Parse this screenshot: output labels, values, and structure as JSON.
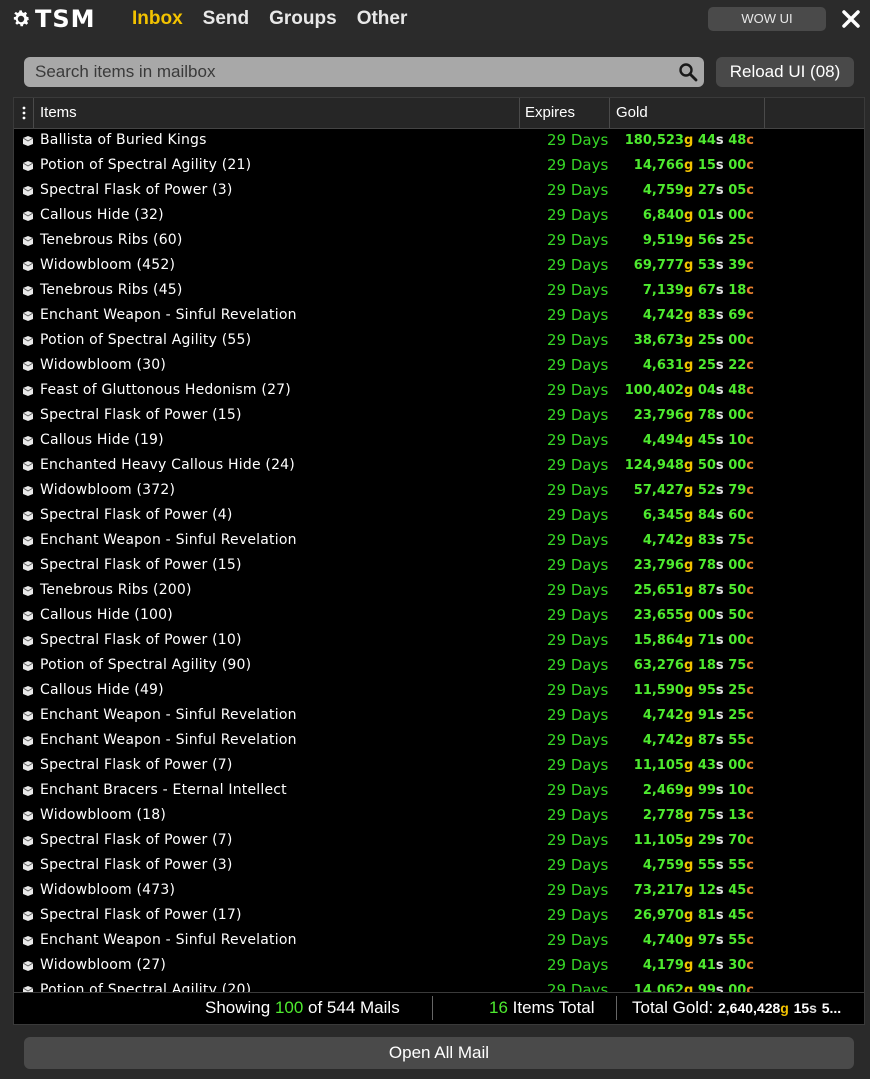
{
  "app": {
    "logo_text": "TSM",
    "tabs": [
      {
        "label": "Inbox",
        "active": true
      },
      {
        "label": "Send",
        "active": false
      },
      {
        "label": "Groups",
        "active": false
      },
      {
        "label": "Other",
        "active": false
      }
    ],
    "wowui_label": "WOW UI"
  },
  "search": {
    "placeholder": "Search items in mailbox",
    "value": ""
  },
  "reload_label": "Reload UI (08)",
  "table": {
    "columns": {
      "items": "Items",
      "expires": "Expires",
      "gold": "Gold"
    },
    "rows": [
      {
        "item": "Ballista of Buried Kings",
        "expires": "29 Days",
        "g": "180,523",
        "s": "44",
        "c": "48"
      },
      {
        "item": "Potion of Spectral Agility (21)",
        "expires": "29 Days",
        "g": "14,766",
        "s": "15",
        "c": "00"
      },
      {
        "item": "Spectral Flask of Power (3)",
        "expires": "29 Days",
        "g": "4,759",
        "s": "27",
        "c": "05"
      },
      {
        "item": "Callous Hide (32)",
        "expires": "29 Days",
        "g": "6,840",
        "s": "01",
        "c": "00"
      },
      {
        "item": "Tenebrous Ribs (60)",
        "expires": "29 Days",
        "g": "9,519",
        "s": "56",
        "c": "25"
      },
      {
        "item": "Widowbloom (452)",
        "expires": "29 Days",
        "g": "69,777",
        "s": "53",
        "c": "39"
      },
      {
        "item": "Tenebrous Ribs (45)",
        "expires": "29 Days",
        "g": "7,139",
        "s": "67",
        "c": "18"
      },
      {
        "item": "Enchant Weapon - Sinful Revelation",
        "expires": "29 Days",
        "g": "4,742",
        "s": "83",
        "c": "69"
      },
      {
        "item": "Potion of Spectral Agility (55)",
        "expires": "29 Days",
        "g": "38,673",
        "s": "25",
        "c": "00"
      },
      {
        "item": "Widowbloom (30)",
        "expires": "29 Days",
        "g": "4,631",
        "s": "25",
        "c": "22"
      },
      {
        "item": "Feast of Gluttonous Hedonism (27)",
        "expires": "29 Days",
        "g": "100,402",
        "s": "04",
        "c": "48"
      },
      {
        "item": "Spectral Flask of Power (15)",
        "expires": "29 Days",
        "g": "23,796",
        "s": "78",
        "c": "00"
      },
      {
        "item": "Callous Hide (19)",
        "expires": "29 Days",
        "g": "4,494",
        "s": "45",
        "c": "10"
      },
      {
        "item": "Enchanted Heavy Callous Hide (24)",
        "expires": "29 Days",
        "g": "124,948",
        "s": "50",
        "c": "00"
      },
      {
        "item": "Widowbloom (372)",
        "expires": "29 Days",
        "g": "57,427",
        "s": "52",
        "c": "79"
      },
      {
        "item": "Spectral Flask of Power (4)",
        "expires": "29 Days",
        "g": "6,345",
        "s": "84",
        "c": "60"
      },
      {
        "item": "Enchant Weapon - Sinful Revelation",
        "expires": "29 Days",
        "g": "4,742",
        "s": "83",
        "c": "75"
      },
      {
        "item": "Spectral Flask of Power (15)",
        "expires": "29 Days",
        "g": "23,796",
        "s": "78",
        "c": "00"
      },
      {
        "item": "Tenebrous Ribs (200)",
        "expires": "29 Days",
        "g": "25,651",
        "s": "87",
        "c": "50"
      },
      {
        "item": "Callous Hide (100)",
        "expires": "29 Days",
        "g": "23,655",
        "s": "00",
        "c": "50"
      },
      {
        "item": "Spectral Flask of Power (10)",
        "expires": "29 Days",
        "g": "15,864",
        "s": "71",
        "c": "00"
      },
      {
        "item": "Potion of Spectral Agility (90)",
        "expires": "29 Days",
        "g": "63,276",
        "s": "18",
        "c": "75"
      },
      {
        "item": "Callous Hide (49)",
        "expires": "29 Days",
        "g": "11,590",
        "s": "95",
        "c": "25"
      },
      {
        "item": "Enchant Weapon - Sinful Revelation",
        "expires": "29 Days",
        "g": "4,742",
        "s": "91",
        "c": "25"
      },
      {
        "item": "Enchant Weapon - Sinful Revelation",
        "expires": "29 Days",
        "g": "4,742",
        "s": "87",
        "c": "55"
      },
      {
        "item": "Spectral Flask of Power (7)",
        "expires": "29 Days",
        "g": "11,105",
        "s": "43",
        "c": "00"
      },
      {
        "item": "Enchant Bracers - Eternal Intellect",
        "expires": "29 Days",
        "g": "2,469",
        "s": "99",
        "c": "10"
      },
      {
        "item": "Widowbloom (18)",
        "expires": "29 Days",
        "g": "2,778",
        "s": "75",
        "c": "13"
      },
      {
        "item": "Spectral Flask of Power (7)",
        "expires": "29 Days",
        "g": "11,105",
        "s": "29",
        "c": "70"
      },
      {
        "item": "Spectral Flask of Power (3)",
        "expires": "29 Days",
        "g": "4,759",
        "s": "55",
        "c": "55"
      },
      {
        "item": "Widowbloom (473)",
        "expires": "29 Days",
        "g": "73,217",
        "s": "12",
        "c": "45"
      },
      {
        "item": "Spectral Flask of Power (17)",
        "expires": "29 Days",
        "g": "26,970",
        "s": "81",
        "c": "45"
      },
      {
        "item": "Enchant Weapon - Sinful Revelation",
        "expires": "29 Days",
        "g": "4,740",
        "s": "97",
        "c": "55"
      },
      {
        "item": "Widowbloom (27)",
        "expires": "29 Days",
        "g": "4,179",
        "s": "41",
        "c": "30"
      },
      {
        "item": "Potion of Spectral Agility (20)",
        "expires": "29 Days",
        "g": "14,062",
        "s": "99",
        "c": "00"
      }
    ]
  },
  "footer": {
    "showing_prefix": "Showing ",
    "showing_count": "100",
    "showing_suffix": " of 544 Mails",
    "items_count": "16",
    "items_suffix": " Items Total",
    "total_label": "Total Gold: ",
    "total_g": "2,640,428",
    "total_s": "15",
    "total_c": "5..."
  },
  "open_all_label": "Open All Mail",
  "colors": {
    "active_tab": "#f2c200",
    "expires_green": "#36d626",
    "gold_number_green": "#4eea2f",
    "gold_unit": "#f2c200",
    "copper_unit": "#e8812e"
  }
}
